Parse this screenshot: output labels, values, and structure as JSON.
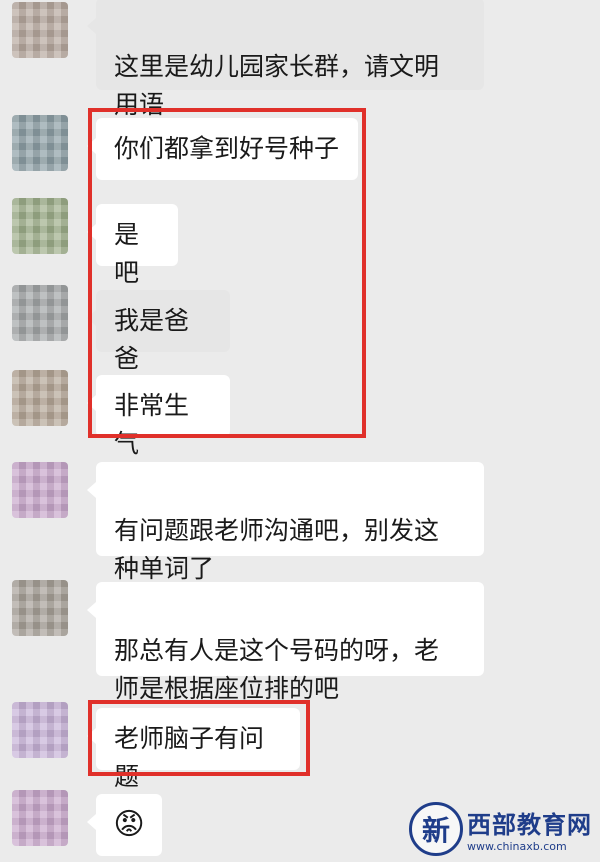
{
  "messages": [
    {
      "text": "这里是幼儿园家长群，请文明\n用语"
    },
    {
      "text": "你们都拿到好号种子"
    },
    {
      "text": "是吧"
    },
    {
      "text": "我是爸爸"
    },
    {
      "text": "非常生气"
    },
    {
      "text": "有问题跟老师沟通吧，别发这\n种单词了"
    },
    {
      "text": "那总有人是这个号码的呀，老\n师是根据座位排的吧"
    },
    {
      "text": "老师脑子有问题"
    },
    {
      "emoji": "😡"
    }
  ],
  "watermark": {
    "logo_char": "新",
    "title": "西部教育网",
    "url": "www.chinaxb.com"
  },
  "colors": {
    "background": "#ebebeb",
    "bubble": "#ffffff",
    "highlight": "#e0302a",
    "watermark": "#1f3d8a"
  }
}
